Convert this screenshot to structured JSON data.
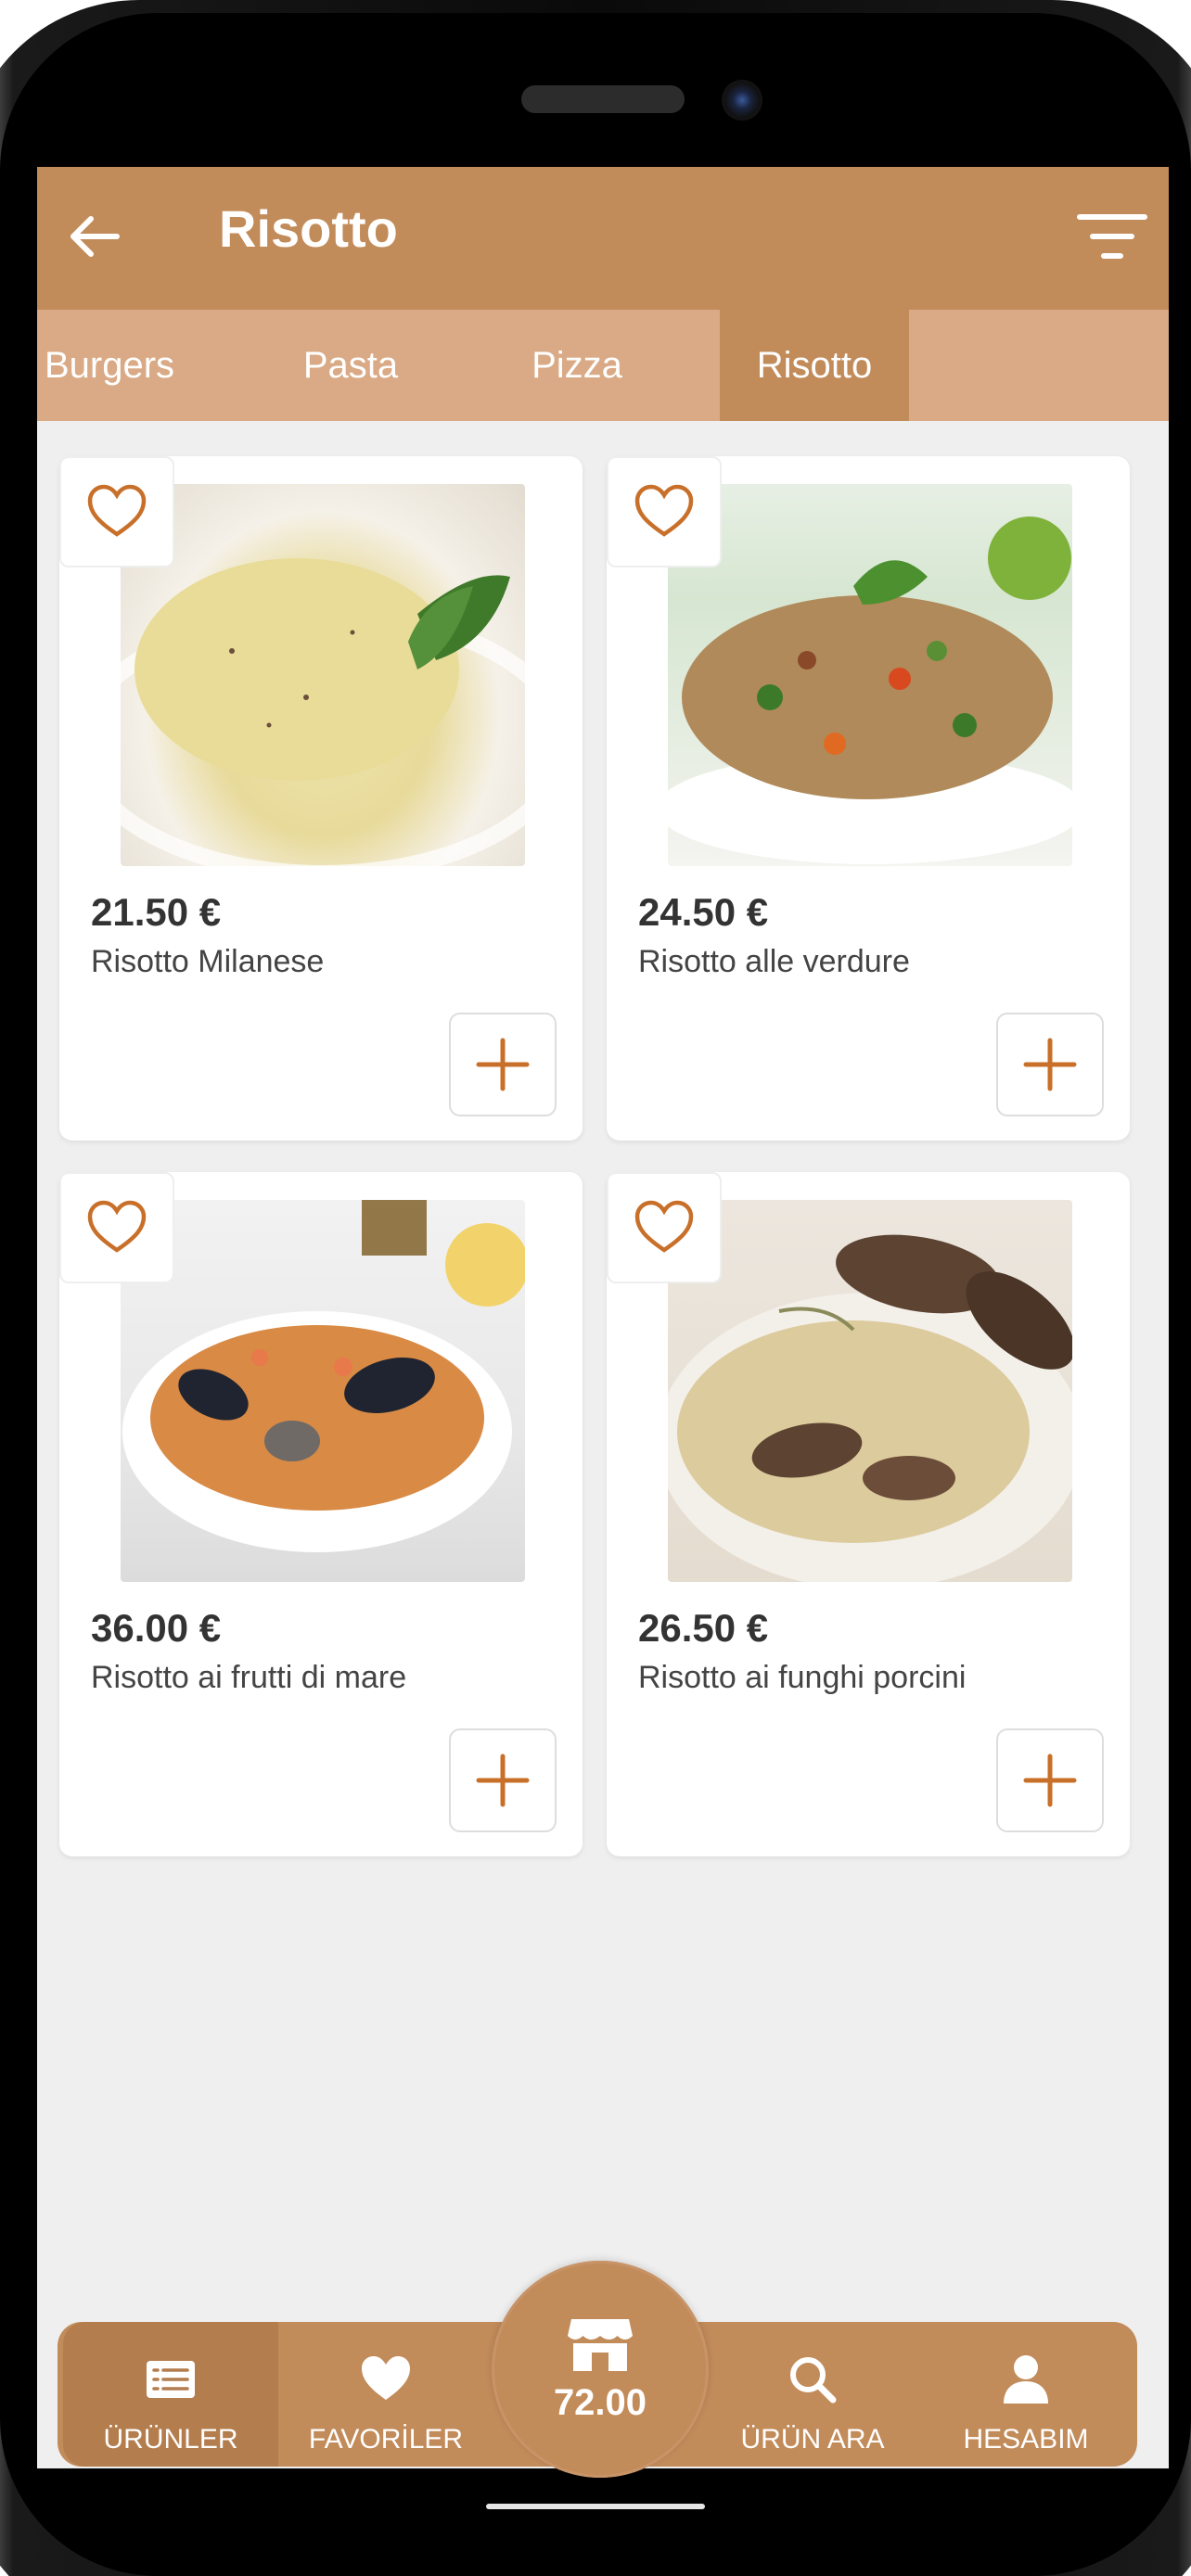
{
  "header": {
    "title": "Risotto"
  },
  "tabs": [
    {
      "label": "Burgers",
      "active": false
    },
    {
      "label": "Pasta",
      "active": false
    },
    {
      "label": "Pizza",
      "active": false
    },
    {
      "label": "Risotto",
      "active": true
    }
  ],
  "products": [
    {
      "price": "21.50 €",
      "name": "Risotto Milanese"
    },
    {
      "price": "24.50 €",
      "name": "Risotto alle verdure"
    },
    {
      "price": "36.00 €",
      "name": "Risotto ai frutti di mare"
    },
    {
      "price": "26.50 €",
      "name": "Risotto ai funghi porcini"
    }
  ],
  "nav": {
    "products_label": "ÜRÜNLER",
    "favorites_label": "FAVORİLER",
    "cart_total": "72.00",
    "search_label": "ÜRÜN ARA",
    "account_label": "HESABIM"
  },
  "colors": {
    "accent": "#c28b5a",
    "tab_bar": "#d9aa85",
    "icon_orange": "#c8702a"
  },
  "icons": [
    "back-arrow-icon",
    "filter-icon",
    "heart-outline-icon",
    "plus-icon",
    "list-icon",
    "heart-icon",
    "store-icon",
    "search-icon",
    "user-icon"
  ]
}
